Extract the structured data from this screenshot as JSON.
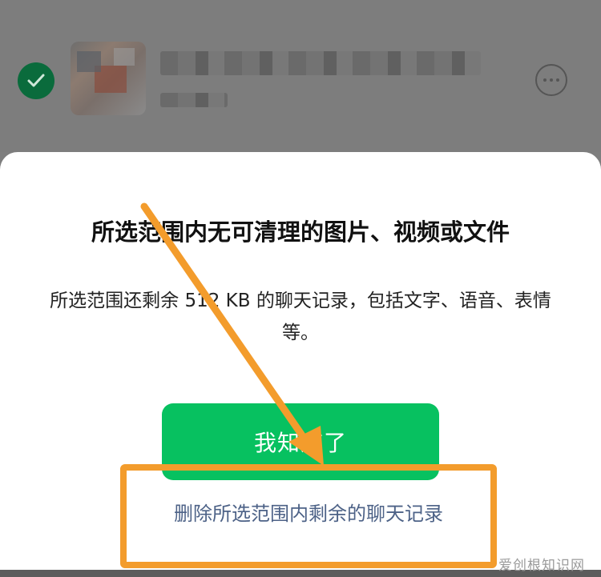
{
  "list_row": {
    "check_icon": "checkmark-icon",
    "more_icon": "more-options-icon"
  },
  "dialog": {
    "title": "所选范围内无可清理的图片、视频或文件",
    "body": "所选范围还剩余 512 KB 的聊天记录，包括文字、语音、表情等。",
    "ok_button_label": "我知道了",
    "delete_link_label": "删除所选范围内剩余的聊天记录"
  },
  "annotation": {
    "color": "#f39c2c"
  },
  "watermark": "爱创根知识网",
  "colors": {
    "accent_green": "#07c160",
    "link_blue": "#4d6287",
    "annotation_orange": "#f39c2c"
  }
}
